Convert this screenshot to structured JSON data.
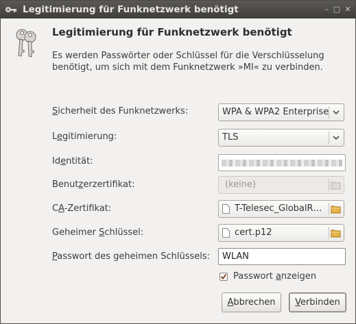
{
  "window": {
    "title": "Legitimierung für Funknetzwerk benötigt",
    "controls": [
      "–",
      "□",
      "✕"
    ]
  },
  "dialog": {
    "heading": "Legitimierung für Funknetzwerk benötigt",
    "description": "Es werden Passwörter oder Schlüssel für die Verschlüsselung benötigt, um sich mit dem Funknetzwerk »MI« zu verbinden."
  },
  "form": {
    "security": {
      "label_pre": "",
      "label_mn": "S",
      "label_post": "icherheit des Funknetzwerks:",
      "value": "WPA & WPA2 Enterprise"
    },
    "auth": {
      "label_pre": "L",
      "label_mn": "e",
      "label_post": "gitimierung:",
      "value": "TLS"
    },
    "identity": {
      "label_pre": "Id",
      "label_mn": "e",
      "label_post": "ntität:",
      "value": ""
    },
    "user_cert": {
      "label_pre": "Benut",
      "label_mn": "z",
      "label_post": "erzertifikat:",
      "value": "(keine)"
    },
    "ca_cert": {
      "label_pre": "C",
      "label_mn": "A",
      "label_post": "-Zertifikat:",
      "value": "T-Telesec_GlobalR…"
    },
    "private_key": {
      "label_pre": "Geheimer ",
      "label_mn": "S",
      "label_post": "chlüssel:",
      "value": "cert.p12"
    },
    "key_password": {
      "label_pre": "",
      "label_mn": "P",
      "label_post": "asswort des geheimen Schlüssels:",
      "value": "WLAN"
    },
    "show_password": {
      "label_pre": "Passwort ",
      "label_mn": "a",
      "label_post": "nzeigen",
      "checked": true
    }
  },
  "buttons": {
    "cancel": {
      "pre": "",
      "mn": "A",
      "post": "bbrechen"
    },
    "connect": {
      "pre": "",
      "mn": "V",
      "post": "erbinden"
    }
  }
}
